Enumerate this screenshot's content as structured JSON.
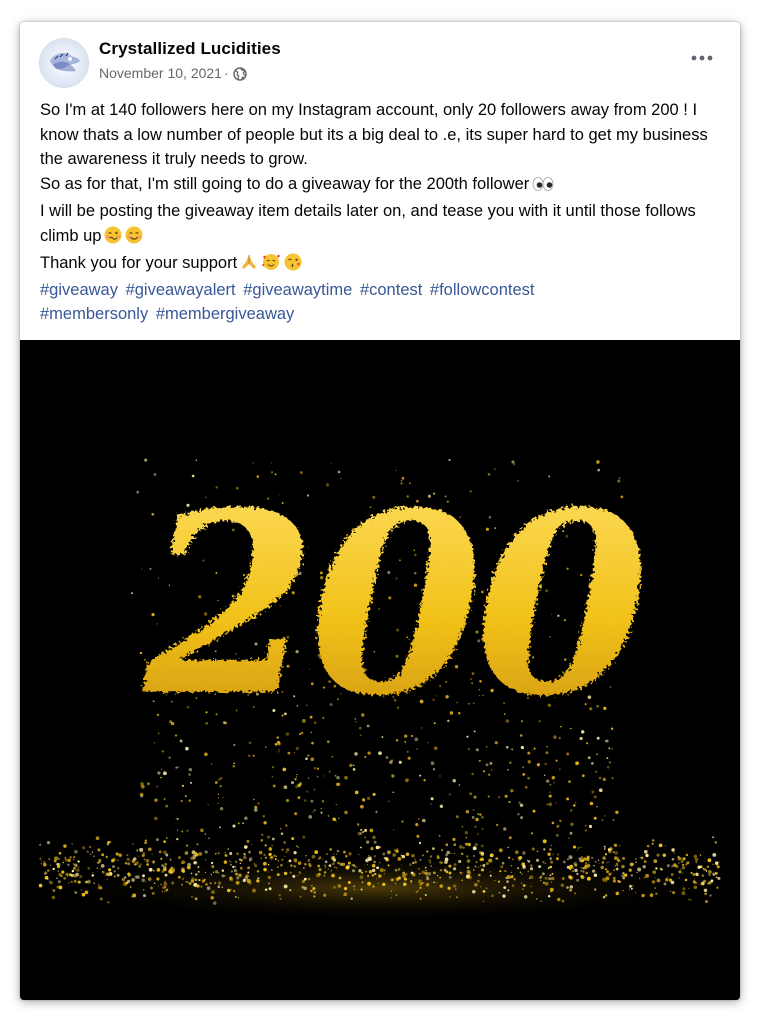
{
  "post": {
    "author": "Crystallized Lucidities",
    "date": "November 10, 2021",
    "date_separator": "·",
    "privacy_icon": "globe-icon",
    "more_icon": "more-options-icon",
    "text_lines": [
      "So I'm at 140 followers here on my Instagram account, only 20 followers away from 200 ! I know thats a low number of people but its a big deal to .e, its super hard to get my business the awareness it truly needs to grow.",
      "So as for that, I'm still going to do a giveaway for the 200th follower",
      "I will be posting the giveaway item details later on, and tease you with it until those follows climb up",
      "Thank you for your support"
    ],
    "emojis": {
      "line2": [
        "eyes-emoji"
      ],
      "line3": [
        "woozy-face-emoji",
        "smiling-face-emoji"
      ],
      "line4": [
        "folded-hands-emoji",
        "smiling-hearts-emoji",
        "face-blowing-kiss-emoji"
      ]
    },
    "hashtags": [
      "#giveaway",
      "#giveawayalert",
      "#giveawaytime",
      "#contest",
      "#followcontest",
      "#membersonly",
      "#membergiveaway"
    ],
    "image": {
      "text": "200",
      "background": "#000000",
      "glitter_color": "#f2c21a"
    }
  },
  "colors": {
    "link": "#385898",
    "meta": "#65676b",
    "text": "#050505"
  }
}
